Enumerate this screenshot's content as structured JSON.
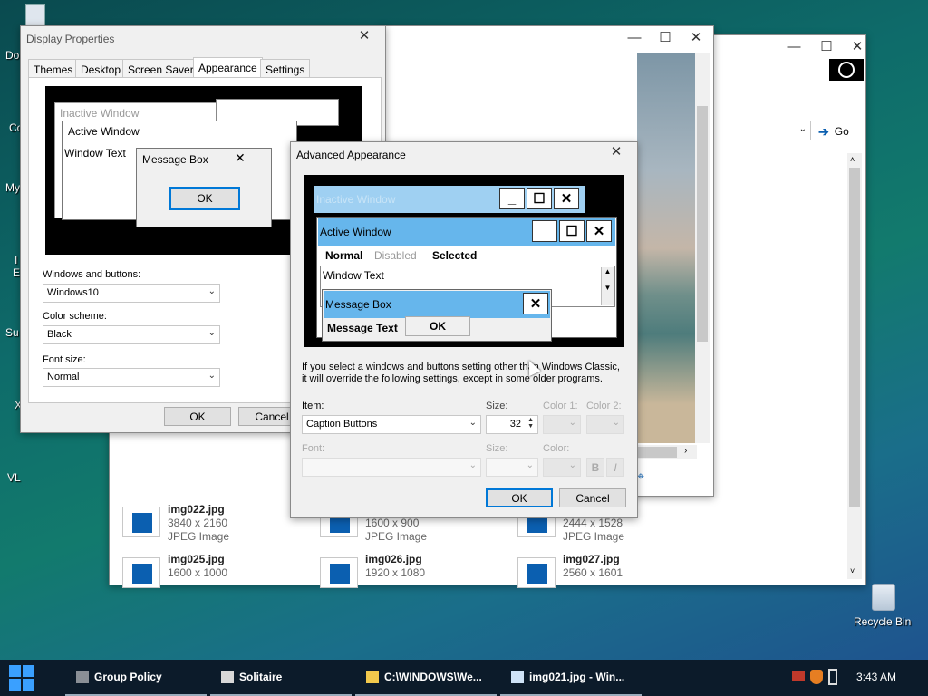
{
  "desktop": {
    "icons": [
      "Do",
      "Co",
      "My",
      "I",
      "E",
      "Su",
      "X",
      "VL"
    ],
    "recycle_label": "Recycle Bin"
  },
  "display_props": {
    "title": "Display Properties",
    "tabs": [
      "Themes",
      "Desktop",
      "Screen Saver",
      "Appearance",
      "Settings"
    ],
    "preview": {
      "inactive": "Inactive Window",
      "active": "Active Window",
      "window_text": "Window Text",
      "message_box": "Message Box",
      "ok": "OK"
    },
    "windows_buttons_label": "Windows and buttons:",
    "windows_buttons_value": "Windows10",
    "color_scheme_label": "Color scheme:",
    "color_scheme_value": "Black",
    "font_size_label": "Font size:",
    "font_size_value": "Normal",
    "ok": "OK",
    "cancel": "Cancel"
  },
  "explorer": {
    "go": "Go",
    "files": [
      {
        "name": "img022.jpg",
        "dims": "3840 x 2160",
        "type": "JPEG Image"
      },
      {
        "name": "",
        "dims": "1600 x 900",
        "type": "JPEG Image"
      },
      {
        "name": "",
        "dims": "2444 x 1528",
        "type": "JPEG Image"
      },
      {
        "name": "img025.jpg",
        "dims": "1600 x 1000",
        "type": ""
      },
      {
        "name": "img026.jpg",
        "dims": "1920 x 1080",
        "type": ""
      },
      {
        "name": "img027.jpg",
        "dims": "2560 x 1601",
        "type": ""
      }
    ]
  },
  "advanced": {
    "title": "Advanced Appearance",
    "preview": {
      "inactive": "Inactive Window",
      "active": "Active Window",
      "normal": "Normal",
      "disabled": "Disabled",
      "selected": "Selected",
      "window_text": "Window Text",
      "message_box": "Message Box",
      "message_text": "Message Text",
      "ok": "OK"
    },
    "info_line1": "If you select a windows and buttons setting other than Windows Classic,",
    "info_line2": "it will override the following settings, except in some older programs.",
    "item_label": "Item:",
    "item_value": "Caption Buttons",
    "size_label": "Size:",
    "size_value": "32",
    "color1_label": "Color 1:",
    "color2_label": "Color 2:",
    "font_label": "Font:",
    "size2_label": "Size:",
    "color_label": "Color:",
    "bold": "B",
    "italic": "I",
    "ok": "OK",
    "cancel": "Cancel"
  },
  "taskbar": {
    "items": [
      "Group Policy",
      "Solitaire",
      "C:\\WINDOWS\\We...",
      "img021.jpg - Win..."
    ],
    "clock": "3:43 AM"
  },
  "colors": {
    "accent": "#0078d7",
    "taskbar": "#0c1b2a",
    "active_caption": "#66b6ec",
    "inactive_caption": "#8ec7ef"
  }
}
